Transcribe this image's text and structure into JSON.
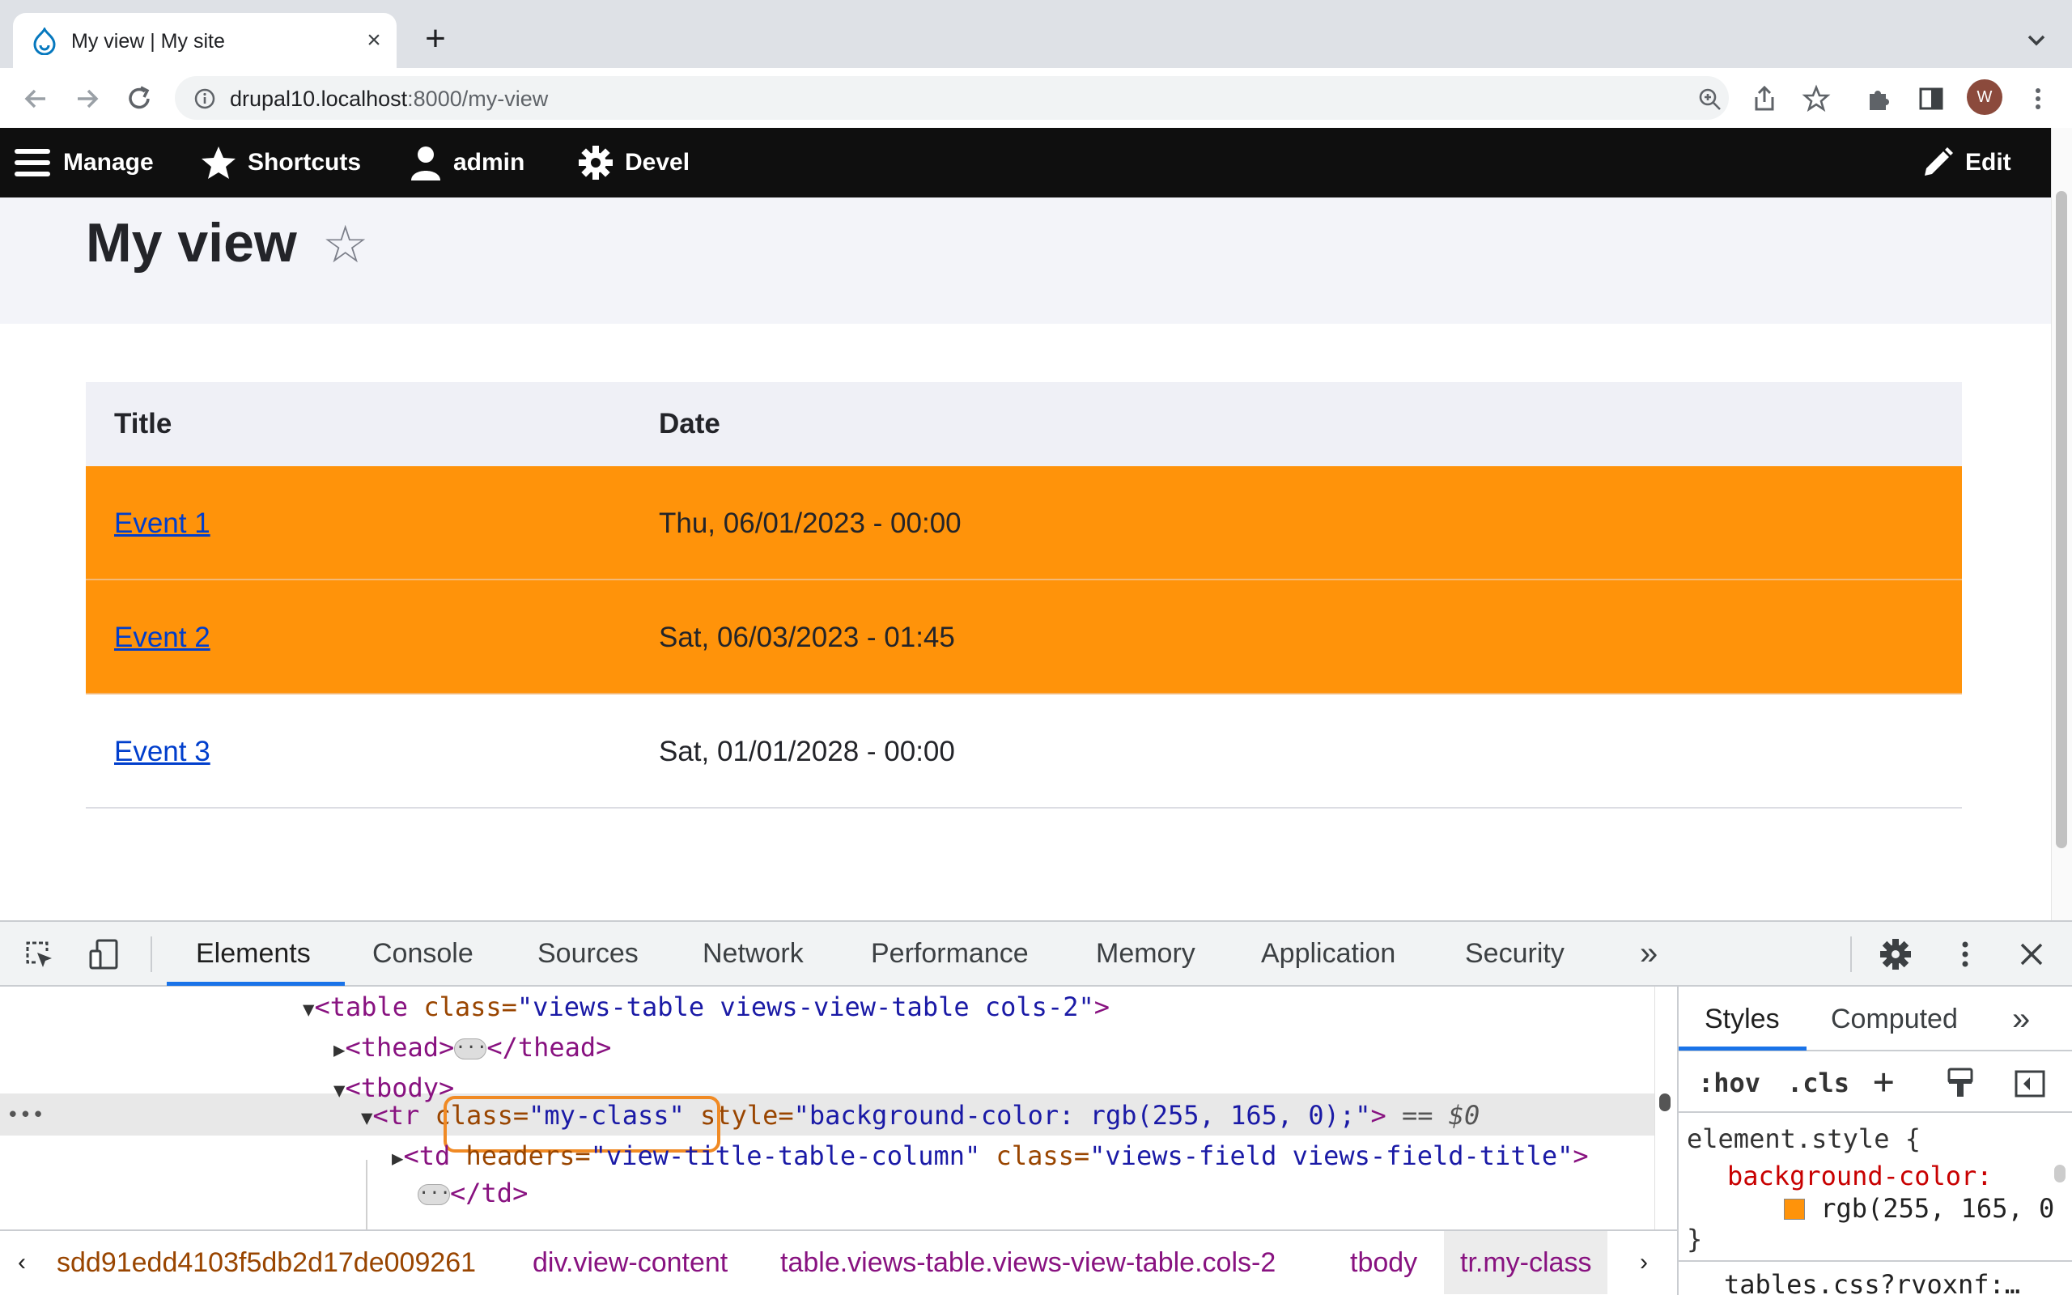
{
  "browser": {
    "tab_title": "My view | My site",
    "tab_close": "×",
    "new_tab": "+",
    "url_host": "drupal10.localhost",
    "url_rest": ":8000/my-view",
    "avatar_letter": "W"
  },
  "admin_toolbar": {
    "manage": "Manage",
    "shortcuts": "Shortcuts",
    "user": "admin",
    "devel": "Devel",
    "edit": "Edit"
  },
  "page": {
    "title": "My view",
    "star": "☆",
    "table": {
      "headers": [
        "Title",
        "Date"
      ],
      "rows": [
        {
          "title": "Event 1",
          "date": "Thu, 06/01/2023 - 00:00",
          "highlight": true
        },
        {
          "title": "Event 2",
          "date": "Sat, 06/03/2023 - 01:45",
          "highlight": true
        },
        {
          "title": "Event 3",
          "date": "Sat, 01/01/2028 - 00:00",
          "highlight": false
        }
      ]
    },
    "highlight_color": "#ff930a"
  },
  "devtools": {
    "tabs": [
      "Elements",
      "Console",
      "Sources",
      "Network",
      "Performance",
      "Memory",
      "Application",
      "Security"
    ],
    "more": "»",
    "elements": {
      "line1_tag_open": "<table",
      "line1_attr": "class=",
      "line1_val": "\"views-table views-view-table cols-2\"",
      "line1_close": ">",
      "line2_open": "<thead>",
      "line2_close": "</thead>",
      "line3": "<tbody>",
      "line4_tag": "<tr",
      "line4_attr1": "class=",
      "line4_val1": "\"my-class\"",
      "line4_attr2": "style=",
      "line4_val2": "\"background-color: rgb(255, 165, 0);\"",
      "line4_close": ">",
      "line4_eq": "== $0",
      "line5_tag": "<td",
      "line5_attr1": "headers=",
      "line5_val1": "\"view-title-table-column\"",
      "line5_attr2": "class=",
      "line5_val2": "\"views-field views-field-title\"",
      "line5_close": ">",
      "line6_close": "</td>",
      "dots": "•••",
      "ellipsis": "···"
    },
    "styles": {
      "tabs": [
        "Styles",
        "Computed"
      ],
      "hov": ":hov",
      "cls": ".cls",
      "plus": "+",
      "selector": "element.style {",
      "prop": "background-color:",
      "value": "rgb(255, 165, 0",
      "close": "}",
      "next_rule": "tables.css?rvoxnf:…"
    },
    "breadcrumbs": [
      "‹",
      "sdd91edd4103f5db2d17de009261",
      "div.view-content",
      "table.views-table.views-view-table.cols-2",
      "tbody",
      "tr.my-class",
      "›"
    ]
  }
}
